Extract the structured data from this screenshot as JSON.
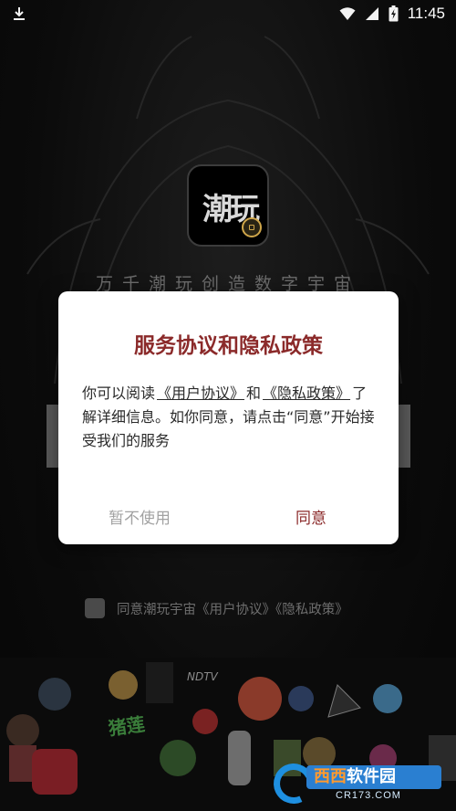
{
  "status_bar": {
    "time": "11:45"
  },
  "splash": {
    "logo_text": "潮玩",
    "tagline": "万千潮玩创造数字宇宙"
  },
  "dialog": {
    "title": "服务协议和隐私政策",
    "body_pre": "你可以阅读",
    "user_agreement_link": "《用户协议》",
    "and": "和",
    "privacy_policy_link": "《隐私政策》",
    "body_post": "了解详细信息。如你同意，请点击“同意”开始接受我们的服务",
    "decline_label": "暂不使用",
    "agree_label": "同意"
  },
  "agree_row": {
    "label": "同意潮玩宇宙《用户协议》《隐私政策》"
  },
  "watermark": {
    "brand_prefix": "西西",
    "brand_suffix": "软件园",
    "url": "CR173.COM"
  },
  "colors": {
    "accent": "#8b2a2a",
    "dialog_bg": "#ffffff",
    "screen_bg": "#0c0c0c"
  }
}
